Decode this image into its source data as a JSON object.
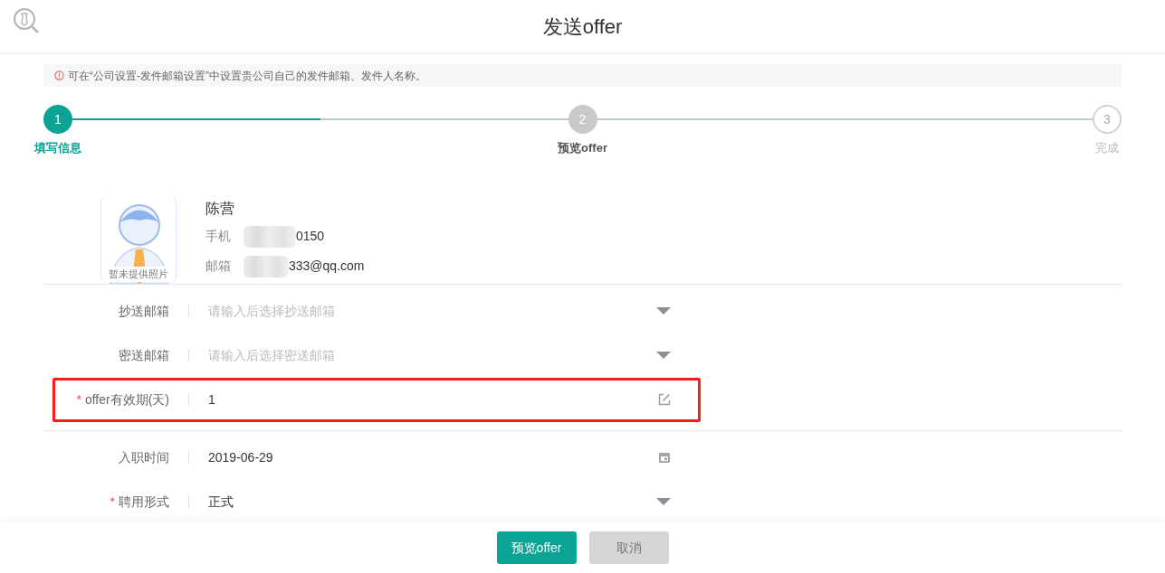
{
  "header": {
    "title": "发送offer"
  },
  "notice": {
    "text": "可在“公司设置-发件邮箱设置”中设置贵公司自己的发件邮箱、发件人名称。"
  },
  "steps": [
    {
      "number": "1",
      "label": "填写信息",
      "selected": true,
      "reached": true
    },
    {
      "number": "2",
      "label": "预览offer",
      "selected": false,
      "reached": true
    },
    {
      "number": "3",
      "label": "完成",
      "selected": false,
      "reached": false
    }
  ],
  "connectors": [
    {
      "level": 0.5
    },
    {
      "level": 0
    }
  ],
  "candidate": {
    "photo_caption": "暂未提供照片",
    "name": "陈营",
    "phone_label": "手机",
    "phone": "0150",
    "email_label": "邮箱",
    "email": "333@qq.com"
  },
  "field_groups": [
    [
      {
        "label": "抄送邮箱",
        "kind": "select",
        "highlighted": false,
        "placeholder": "请输入后选择抄送邮箱"
      },
      {
        "label": "密送邮箱",
        "kind": "select",
        "highlighted": false,
        "placeholder": "请输入后选择密送邮箱"
      },
      {
        "marker": "*",
        "label": "offer有效期(天)",
        "kind": "edit",
        "highlighted": true,
        "value": "1"
      }
    ],
    [
      {
        "label": "入职时间",
        "kind": "date",
        "highlighted": false,
        "value": "2019-06-29"
      },
      {
        "marker": "*",
        "label": "聘用形式",
        "kind": "select",
        "highlighted": false,
        "value": "正式"
      }
    ]
  ],
  "footer": {
    "buttons": [
      {
        "label": "预览offer",
        "kind": "primary"
      },
      {
        "label": "取消",
        "kind": "secondary"
      }
    ]
  }
}
